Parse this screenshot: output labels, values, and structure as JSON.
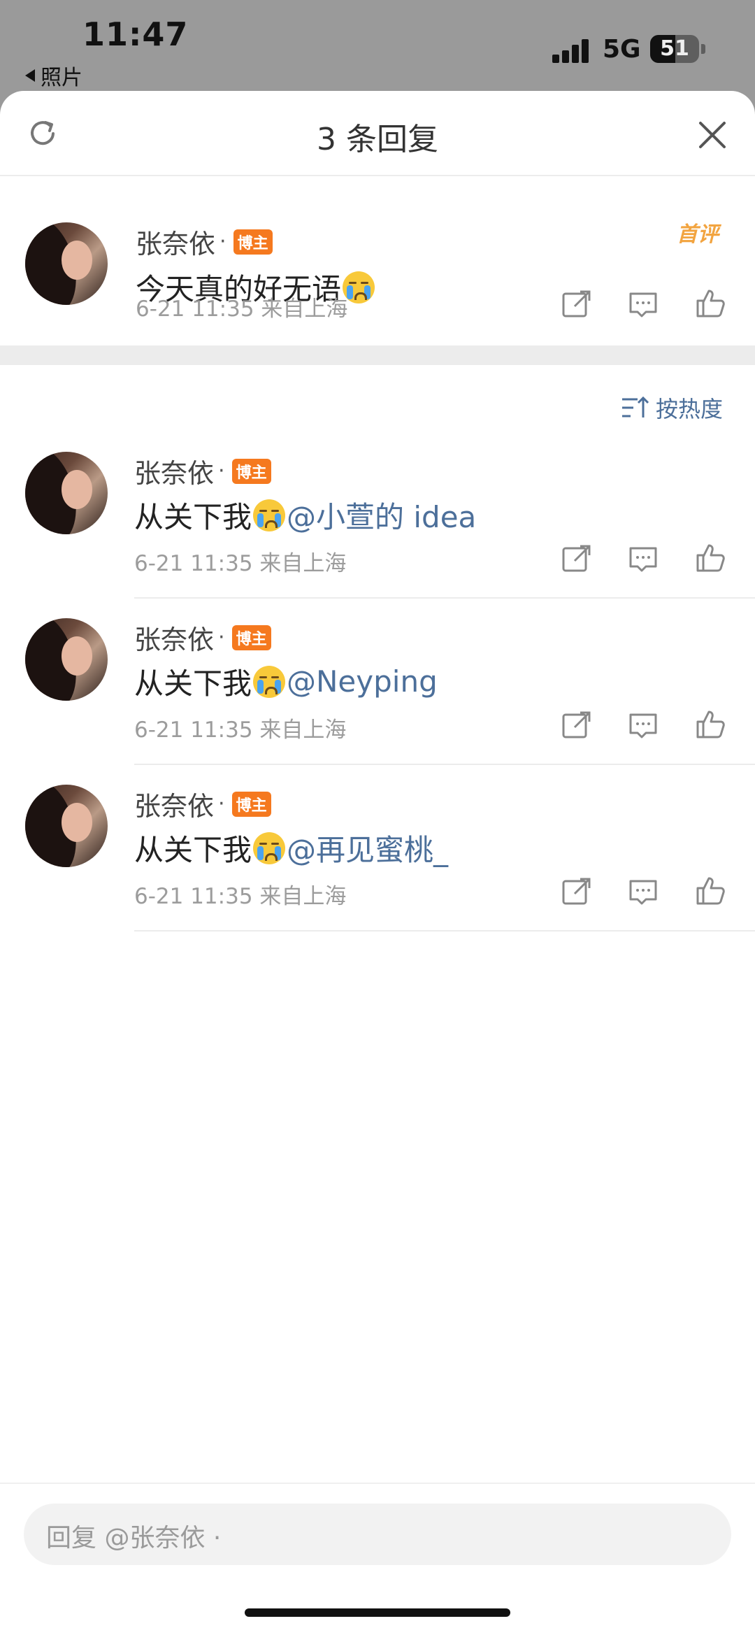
{
  "status_bar": {
    "time": "11:47",
    "back_app": "照片",
    "network": "5G",
    "battery": "51",
    "battery_level": 0.51
  },
  "sheet": {
    "title": "3 条回复"
  },
  "main_comment": {
    "author": "张奈依",
    "separator": "·",
    "badge": "博主",
    "text": "今天真的好无语",
    "time": "6-21 11:35",
    "location": "来自上海",
    "first_label": "首评"
  },
  "sort": {
    "label": "按热度"
  },
  "replies": [
    {
      "author": "张奈依",
      "separator": "·",
      "badge": "博主",
      "text": "从关下我",
      "mention": "@小萱的 idea",
      "time": "6-21 11:35",
      "location": "来自上海"
    },
    {
      "author": "张奈依",
      "separator": "·",
      "badge": "博主",
      "text": "从关下我",
      "mention": "@Neyping",
      "time": "6-21 11:35",
      "location": "来自上海"
    },
    {
      "author": "张奈依",
      "separator": "·",
      "badge": "博主",
      "text": "从关下我",
      "mention": "@再见蜜桃_",
      "time": "6-21 11:35",
      "location": "来自上海"
    }
  ],
  "reply_input": {
    "placeholder": "回复 @张奈依 ·"
  },
  "icons": {
    "emoji": "crying-face-icon",
    "share": "share-icon",
    "comment": "comment-icon",
    "like": "like-icon"
  },
  "colors": {
    "badge": "#f5791f",
    "mention": "#4c6f9a",
    "first_label": "#f2a440"
  }
}
